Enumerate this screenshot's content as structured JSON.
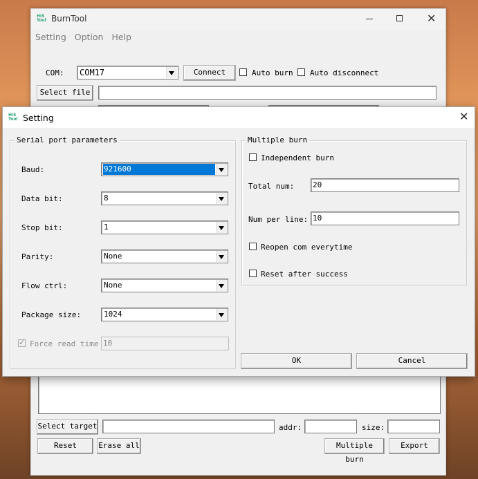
{
  "main": {
    "title": "BurnTool",
    "menu": [
      "Setting",
      "Option",
      "Help"
    ],
    "com_label": "COM:",
    "com_value": "COM17",
    "connect": "Connect",
    "auto_burn": "Auto burn",
    "auto_disconnect": "Auto disconnect",
    "select_file": "Select file",
    "select_target": "Select target",
    "addr_label": "addr:",
    "size_label": "size:",
    "reset": "Reset",
    "erase_all": "Erase all",
    "multiple_burn": "Multiple burn",
    "export": "Export"
  },
  "dialog": {
    "title": "Setting",
    "serial_group": "Serial port parameters",
    "baud_label": "Baud:",
    "baud_value": "921600",
    "databit_label": "Data bit:",
    "databit_value": "8",
    "stopbit_label": "Stop bit:",
    "stopbit_value": "1",
    "parity_label": "Parity:",
    "parity_value": "None",
    "flow_label": "Flow ctrl:",
    "flow_value": "None",
    "package_label": "Package size:",
    "package_value": "1024",
    "force_read_label": "Force read time",
    "force_read_value": "10",
    "multi_group": "Multiple burn",
    "independent_burn": "Independent burn",
    "total_label": "Total num:",
    "total_value": "20",
    "perline_label": "Num per line:",
    "perline_value": "10",
    "reopen": "Reopen com everytime",
    "reset_after": "Reset after success",
    "ok": "OK",
    "cancel": "Cancel"
  },
  "colors": {
    "selection": "#0078d7",
    "window": "#f0f0f0"
  }
}
